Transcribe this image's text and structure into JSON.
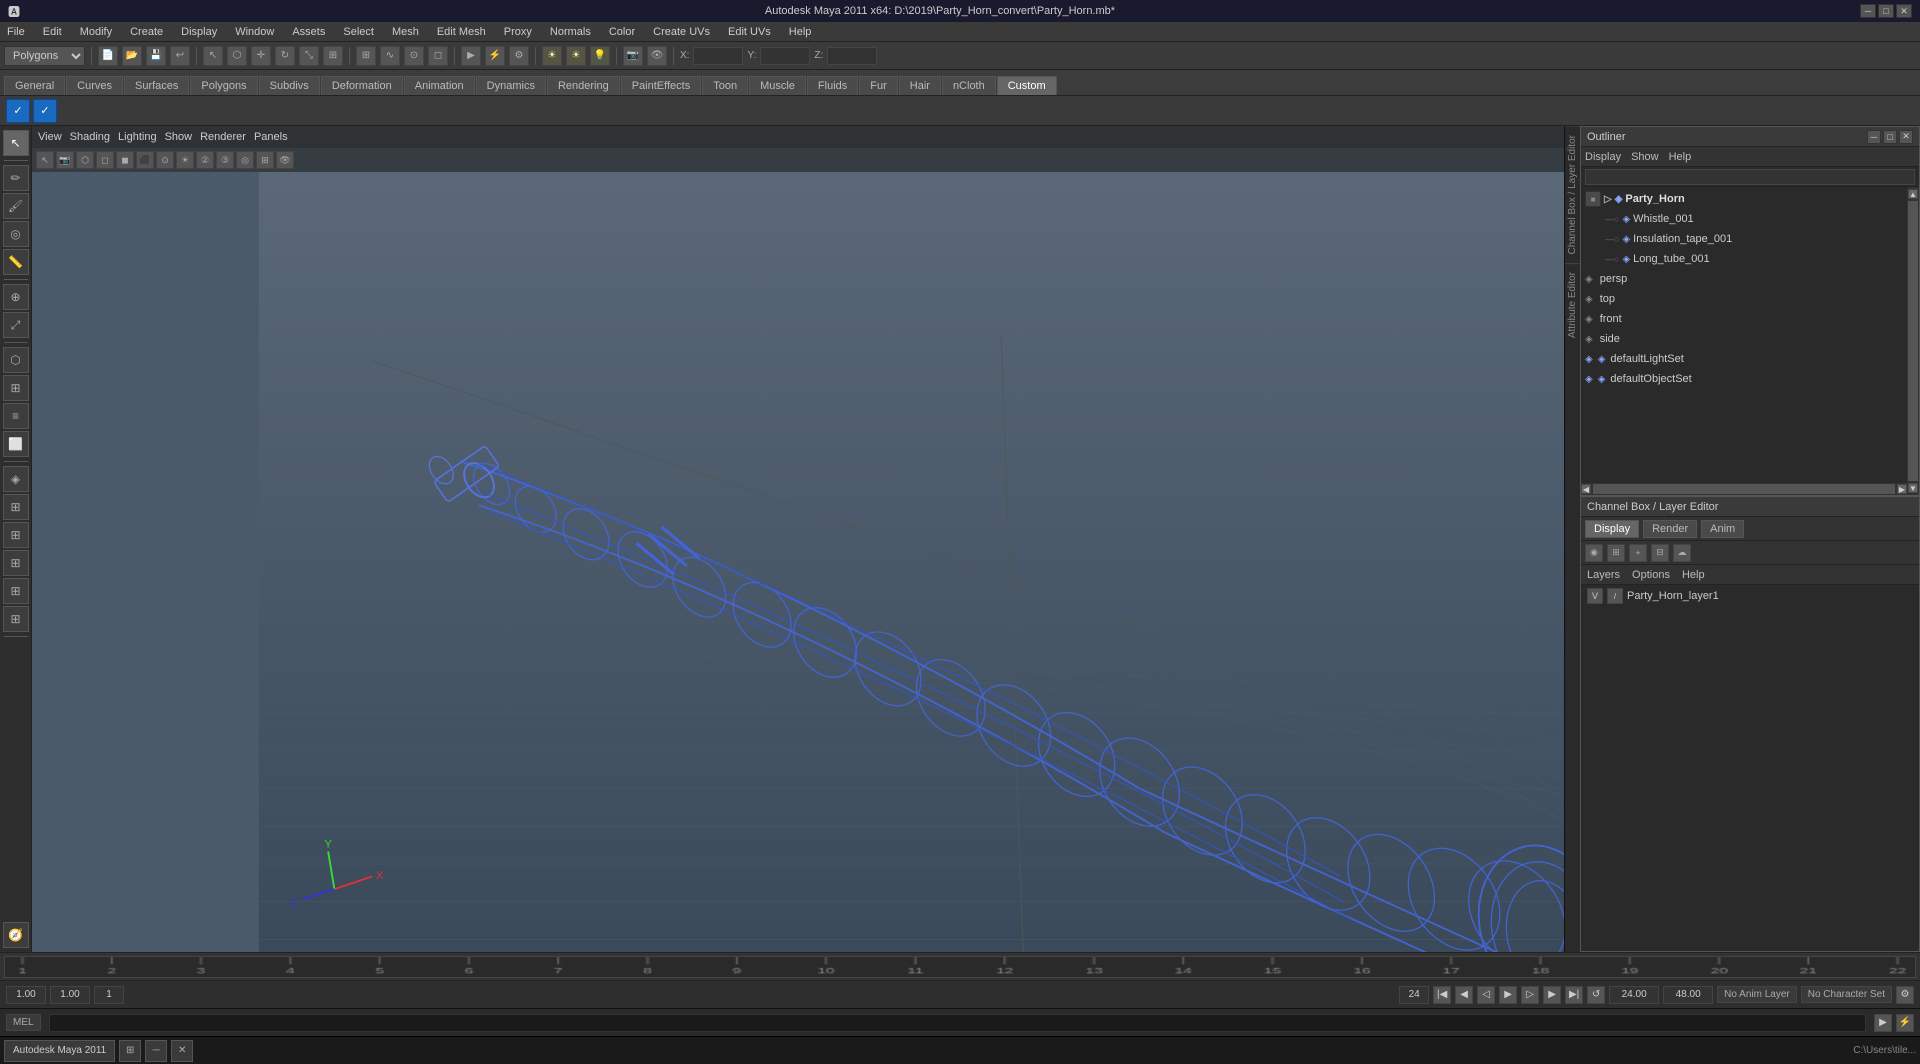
{
  "titleBar": {
    "title": "Autodesk Maya 2011 x64: D:\\2019\\Party_Horn_convert\\Party_Horn.mb*",
    "minBtn": "─",
    "maxBtn": "□",
    "closeBtn": "✕"
  },
  "menuBar": {
    "items": [
      "File",
      "Edit",
      "Modify",
      "Create",
      "Display",
      "Window",
      "Assets",
      "Select",
      "Mesh",
      "Edit Mesh",
      "Proxy",
      "Normals",
      "Color",
      "Create UVs",
      "Edit UVs",
      "Help"
    ]
  },
  "modeSelector": {
    "value": "Polygons"
  },
  "tabs": {
    "items": [
      "General",
      "Curves",
      "Surfaces",
      "Polygons",
      "Subdivs",
      "Deformation",
      "Animation",
      "Dynamics",
      "Rendering",
      "PaintEffects",
      "Toon",
      "Muscle",
      "Fluids",
      "Fur",
      "Hair",
      "nCloth",
      "Custom"
    ]
  },
  "viewport": {
    "menuItems": [
      "View",
      "Shading",
      "Lighting",
      "Show",
      "Renderer",
      "Panels"
    ],
    "coords": {
      "x": {
        "label": "X:",
        "value": ""
      },
      "y": {
        "label": "Y:",
        "value": ""
      },
      "z": {
        "label": "Z:",
        "value": ""
      }
    }
  },
  "outliner": {
    "title": "Outliner",
    "menuItems": [
      "Display",
      "Show",
      "Help"
    ],
    "tree": [
      {
        "id": "party_horn",
        "label": "Party_Horn",
        "level": 0,
        "icon": "▷",
        "expanded": true,
        "type": "group"
      },
      {
        "id": "whistle_001",
        "label": "Whistle_001",
        "level": 1,
        "icon": "○",
        "type": "mesh"
      },
      {
        "id": "insulation_tape_001",
        "label": "Insulation_tape_001",
        "level": 1,
        "icon": "○",
        "type": "mesh"
      },
      {
        "id": "long_tube_001",
        "label": "Long_tube_001",
        "level": 1,
        "icon": "○",
        "type": "mesh"
      },
      {
        "id": "persp",
        "label": "persp",
        "level": 0,
        "icon": "○",
        "type": "camera"
      },
      {
        "id": "top",
        "label": "top",
        "level": 0,
        "icon": "○",
        "type": "camera"
      },
      {
        "id": "front",
        "label": "front",
        "level": 0,
        "icon": "○",
        "type": "camera"
      },
      {
        "id": "side",
        "label": "side",
        "level": 0,
        "icon": "○",
        "type": "camera"
      },
      {
        "id": "defaultLightSet",
        "label": "defaultLightSet",
        "level": 0,
        "icon": "◈",
        "type": "set"
      },
      {
        "id": "defaultObjectSet",
        "label": "defaultObjectSet",
        "level": 0,
        "icon": "◈",
        "type": "set"
      }
    ]
  },
  "channelBox": {
    "headerLabel": "Channel Box / Layer Editor",
    "tabs": [
      "Display",
      "Render",
      "Anim"
    ]
  },
  "layers": {
    "menuItems": [
      "Layers",
      "Options",
      "Help"
    ],
    "items": [
      {
        "label": "Party_Horn_layer1",
        "v": "V",
        "visible": true
      }
    ]
  },
  "timeline": {
    "start": 1,
    "end": 24,
    "current": "1.00",
    "rangeStart": "1.00",
    "rangeEnd": "1.00",
    "ticks": [
      1,
      2,
      3,
      4,
      5,
      6,
      7,
      8,
      9,
      10,
      11,
      12,
      13,
      14,
      15,
      16,
      17,
      18,
      19,
      20,
      21,
      22
    ],
    "playHead": "24",
    "animEndField": "24.00",
    "animEndField2": "48.00",
    "noAnimLayer": "No Anim Layer",
    "noCharSet": "No Character Set"
  },
  "statusBar": {
    "melLabel": "MEL",
    "commandField": "",
    "path": "C:\\Users\\tile..."
  },
  "taskbar": {
    "appName": "Autodesk Maya 2011",
    "icons": [
      "⊞",
      "─",
      "✕"
    ]
  },
  "sideLabels": {
    "channelBox": "Channel Box / Layer Editor",
    "attributeEditor": "Attribute Editor"
  }
}
